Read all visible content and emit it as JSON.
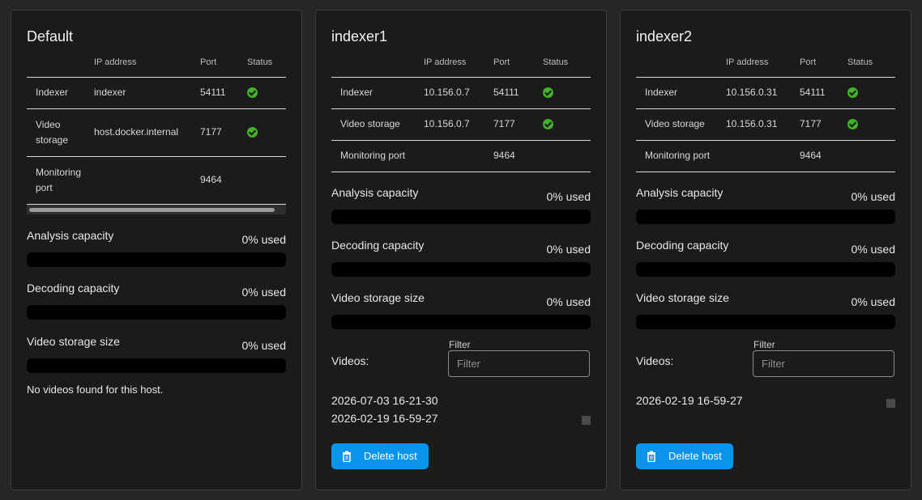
{
  "columns": {
    "name": "",
    "ip": "IP address",
    "port": "Port",
    "status": "Status"
  },
  "capacity_labels": {
    "analysis": "Analysis capacity",
    "decoding": "Decoding capacity",
    "storage": "Video storage size"
  },
  "hosts": [
    {
      "title": "Default",
      "rows": [
        {
          "name": "Indexer",
          "ip": "indexer",
          "port": "54111",
          "status_icon": "check-circle-icon",
          "ok": true
        },
        {
          "name": "Video storage",
          "ip": "host.docker.internal",
          "port": "7177",
          "status_icon": "check-circle-icon",
          "ok": true
        },
        {
          "name": "Monitoring port",
          "ip": "",
          "port": "9464",
          "ok": false
        }
      ],
      "capacity": {
        "analysis": {
          "used_text": "0% used",
          "used_fraction": 0
        },
        "decoding": {
          "used_text": "0% used",
          "used_fraction": 0
        },
        "storage": {
          "used_text": "0% used",
          "used_fraction": 0
        }
      },
      "no_videos": "No videos found for this host."
    },
    {
      "title": "indexer1",
      "rows": [
        {
          "name": "Indexer",
          "ip": "10.156.0.7",
          "port": "54111",
          "status_icon": "check-circle-icon",
          "ok": true
        },
        {
          "name": "Video storage",
          "ip": "10.156.0.7",
          "port": "7177",
          "status_icon": "check-circle-icon",
          "ok": true
        },
        {
          "name": "Monitoring port",
          "ip": "",
          "port": "9464",
          "ok": false
        }
      ],
      "capacity": {
        "analysis": {
          "used_text": "0% used",
          "used_fraction": 0
        },
        "decoding": {
          "used_text": "0% used",
          "used_fraction": 0
        },
        "storage": {
          "used_text": "0% used",
          "used_fraction": 0
        }
      },
      "videos_label": "Videos:",
      "filter": {
        "label": "Filter",
        "placeholder": "Filter",
        "value": ""
      },
      "videos": [
        "2026-07-03 16-21-30",
        "2026-02-19 16-59-27"
      ],
      "delete_label": "Delete host"
    },
    {
      "title": "indexer2",
      "rows": [
        {
          "name": "Indexer",
          "ip": "10.156.0.31",
          "port": "54111",
          "status_icon": "check-circle-icon",
          "ok": true
        },
        {
          "name": "Video storage",
          "ip": "10.156.0.31",
          "port": "7177",
          "status_icon": "check-circle-icon",
          "ok": true
        },
        {
          "name": "Monitoring port",
          "ip": "",
          "port": "9464",
          "ok": false
        }
      ],
      "capacity": {
        "analysis": {
          "used_text": "0% used",
          "used_fraction": 0
        },
        "decoding": {
          "used_text": "0% used",
          "used_fraction": 0
        },
        "storage": {
          "used_text": "0% used",
          "used_fraction": 0
        }
      },
      "videos_label": "Videos:",
      "filter": {
        "label": "Filter",
        "placeholder": "Filter",
        "value": ""
      },
      "videos": [
        "2026-02-19 16-59-27"
      ],
      "delete_label": "Delete host"
    }
  ],
  "colors": {
    "accent": "#0a93ea",
    "status_ok": "#43b02a",
    "panel_bg": "#1b1b1b",
    "page_bg": "#262626"
  }
}
